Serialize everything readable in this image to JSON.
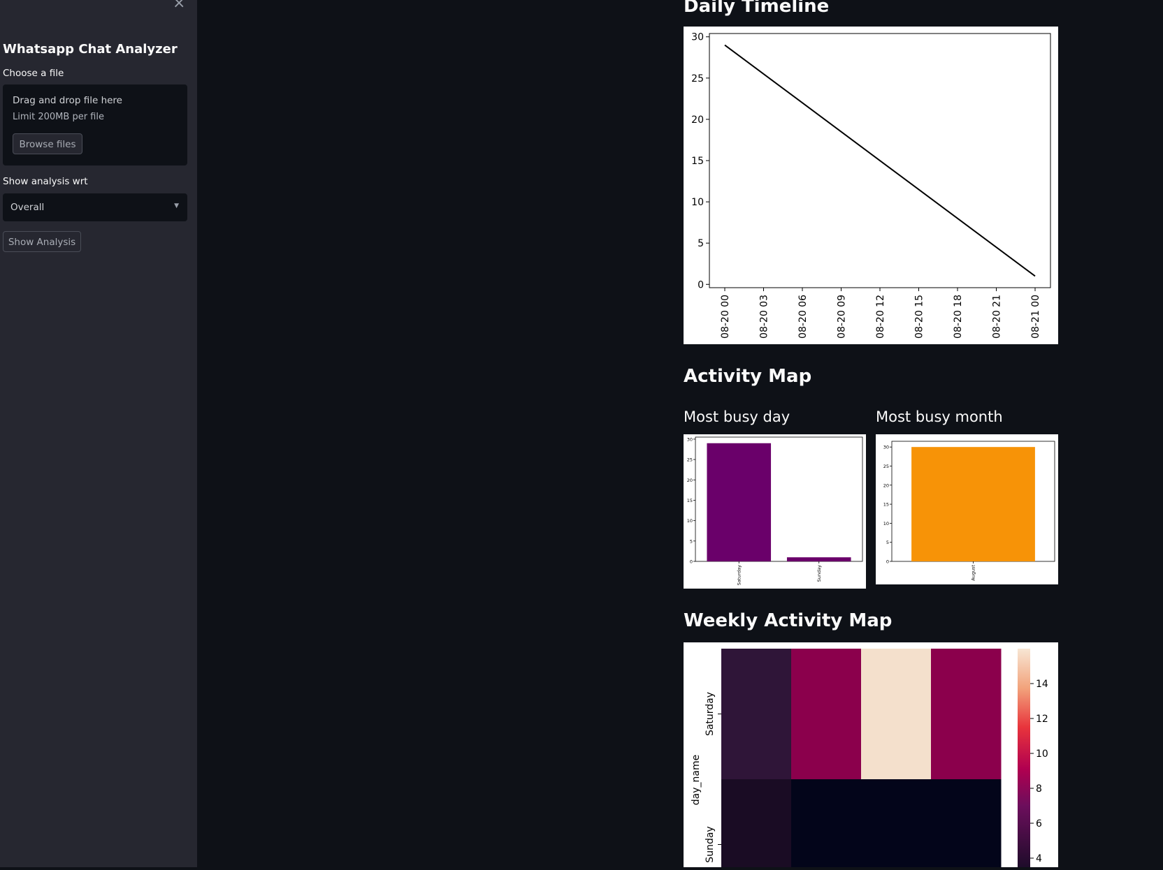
{
  "sidebar": {
    "close_icon": "×",
    "title": "Whatsapp Chat Analyzer",
    "file_label": "Choose a file",
    "uploader": {
      "line1": "Drag and drop file here",
      "line2": "Limit 200MB per file",
      "browse_label": "Browse files"
    },
    "analysis_label": "Show analysis wrt",
    "analysis_select": {
      "value": "Overall"
    },
    "show_button": "Show Analysis"
  },
  "main": {
    "daily_timeline_title": "Daily Timeline",
    "activity_map_title": "Activity Map",
    "most_busy_day_title": "Most busy day",
    "most_busy_month_title": "Most busy month",
    "weekly_activity_title": "Weekly Activity Map"
  },
  "chart_data": [
    {
      "type": "line",
      "x": [
        "08-20 00",
        "08-21 00"
      ],
      "y": [
        29,
        1
      ],
      "xticks": [
        "08-20 00",
        "08-20 03",
        "08-20 06",
        "08-20 09",
        "08-20 12",
        "08-20 15",
        "08-20 18",
        "08-20 21",
        "08-21 00"
      ],
      "yticks": [
        0,
        5,
        10,
        15,
        20,
        25,
        30
      ],
      "ylim": [
        -0.4,
        30.4
      ],
      "color": "#000000"
    },
    {
      "type": "bar",
      "categories": [
        "Saturday",
        "Sunday"
      ],
      "values": [
        29,
        1
      ],
      "yticks": [
        0,
        5,
        10,
        15,
        20,
        25,
        30
      ],
      "ylim": [
        0,
        30.5
      ],
      "color": "#6a006a"
    },
    {
      "type": "bar",
      "categories": [
        "August"
      ],
      "values": [
        30
      ],
      "yticks": [
        0,
        5,
        10,
        15,
        20,
        25,
        30
      ],
      "ylim": [
        0,
        31.5
      ],
      "color": "#f79307"
    },
    {
      "type": "heatmap",
      "rows": [
        "Saturday",
        "Sunday"
      ],
      "ylabel": "day_name",
      "values": [
        [
          5,
          9,
          15,
          9
        ],
        [
          4,
          2.5,
          2.5,
          2.5
        ]
      ],
      "colors": [
        [
          "#2f1538",
          "#8b004c",
          "#f4e0cc",
          "#8b004c"
        ],
        [
          "#1a0c24",
          "#03051a",
          "#03051a",
          "#03051a"
        ]
      ],
      "colorbar_ticks": [
        4,
        6,
        8,
        10,
        12,
        14
      ]
    }
  ]
}
